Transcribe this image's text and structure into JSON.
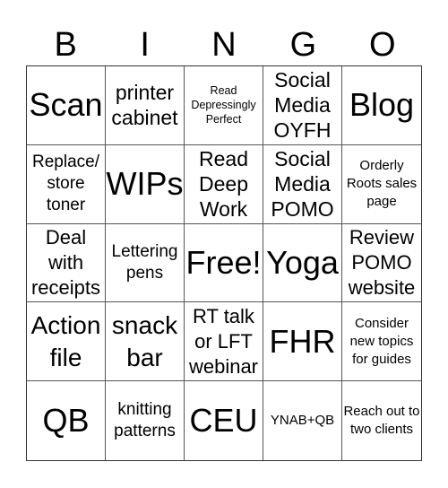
{
  "header": {
    "letters": [
      "B",
      "I",
      "N",
      "G",
      "O"
    ]
  },
  "cells": [
    "Scan",
    "printer cabinet",
    "Read Depressingly Perfect",
    "Social Media OYFH",
    "Blog",
    "Replace/ store toner",
    "WIPs",
    "Read Deep Work",
    "Social Media POMO",
    "Orderly Roots sales page",
    "Deal with receipts",
    "Lettering pens",
    "Free!",
    "Yoga",
    "Review POMO website",
    "Action file",
    "snack bar",
    "RT talk or LFT webinar",
    "FHR",
    "Consider new topics for guides",
    "QB",
    "knitting patterns",
    "CEU",
    "YNAB+QB",
    "Reach out to two clients"
  ]
}
